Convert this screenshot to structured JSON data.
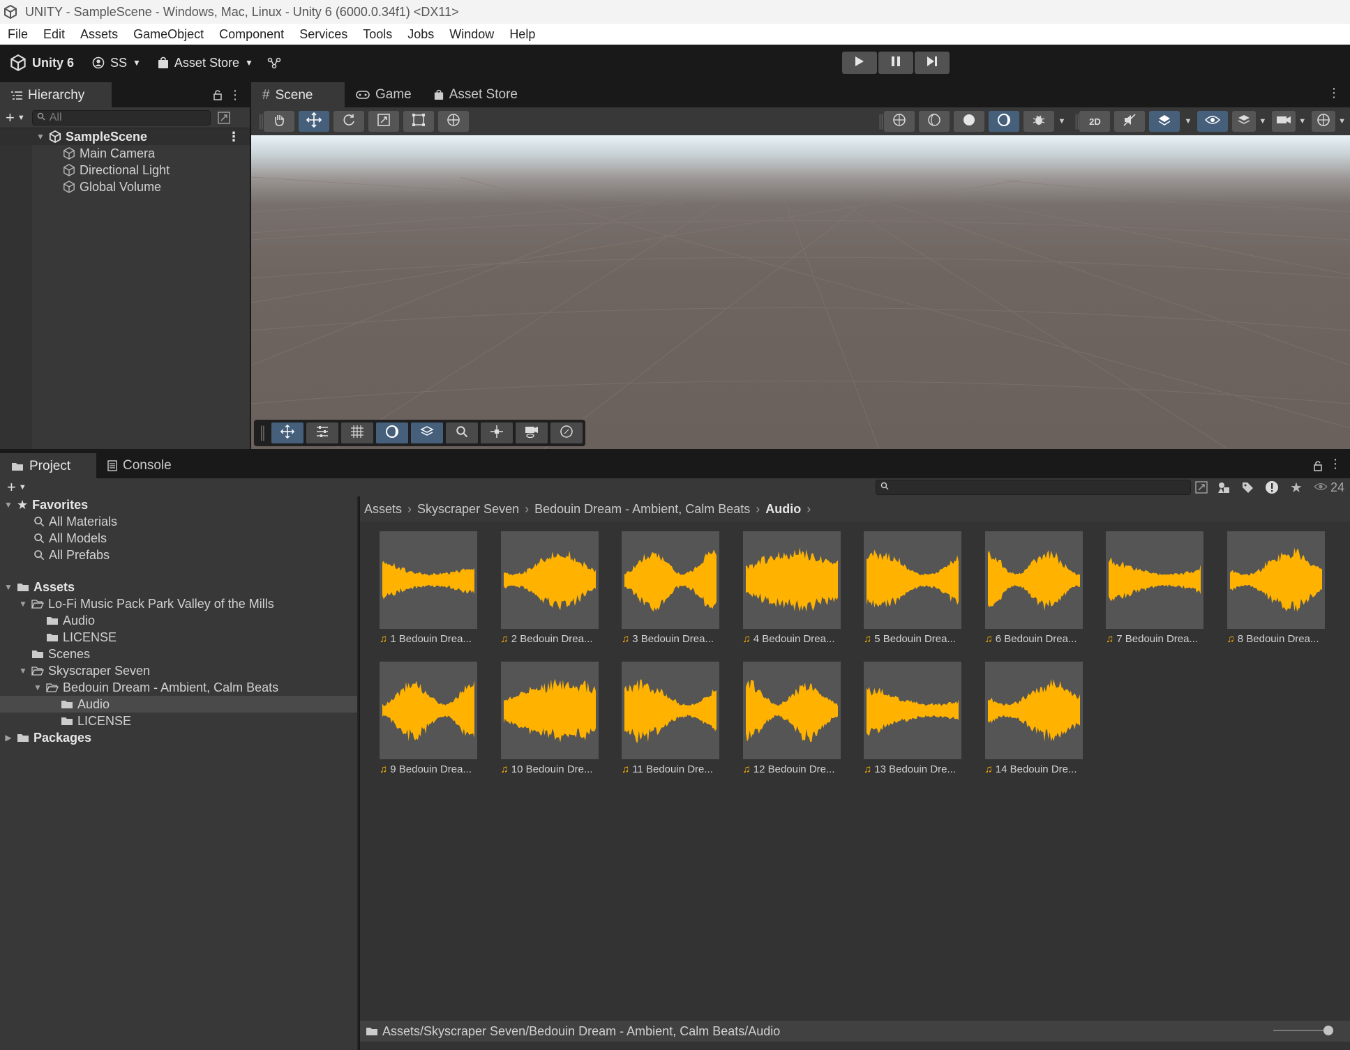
{
  "window": {
    "title": "UNITY - SampleScene - Windows, Mac, Linux - Unity 6 (6000.0.34f1) <DX11>"
  },
  "menu": [
    "File",
    "Edit",
    "Assets",
    "GameObject",
    "Component",
    "Services",
    "Tools",
    "Jobs",
    "Window",
    "Help"
  ],
  "toolbar": {
    "product": "Unity 6",
    "account": "SS",
    "asset_store": "Asset Store"
  },
  "hierarchy": {
    "tab": "Hierarchy",
    "search_placeholder": "All",
    "scene": "SampleScene",
    "items": [
      "Main Camera",
      "Directional Light",
      "Global Volume"
    ]
  },
  "scene_tabs": [
    "Scene",
    "Game",
    "Asset Store"
  ],
  "project": {
    "tabs": [
      "Project",
      "Console"
    ],
    "visible_count": "24",
    "favorites": {
      "label": "Favorites",
      "items": [
        "All Materials",
        "All Models",
        "All Prefabs"
      ]
    },
    "assets_label": "Assets",
    "tree": [
      {
        "label": "Lo-Fi Music Pack  Park Valley of the Mills",
        "level": 1,
        "arrow": "down"
      },
      {
        "label": "Audio",
        "level": 2,
        "arrow": ""
      },
      {
        "label": "LICENSE",
        "level": 2,
        "arrow": ""
      },
      {
        "label": "Scenes",
        "level": 1,
        "arrow": ""
      },
      {
        "label": "Skyscraper Seven",
        "level": 1,
        "arrow": "down"
      },
      {
        "label": "Bedouin Dream - Ambient, Calm Beats",
        "level": 2,
        "arrow": "down"
      },
      {
        "label": "Audio",
        "level": 3,
        "arrow": "",
        "selected": true
      },
      {
        "label": "LICENSE",
        "level": 3,
        "arrow": ""
      }
    ],
    "packages_label": "Packages",
    "breadcrumb": [
      "Assets",
      "Skyscraper Seven",
      "Bedouin Dream - Ambient, Calm Beats",
      "Audio"
    ],
    "assets": [
      "1 Bedouin Drea...",
      "2 Bedouin Drea...",
      "3 Bedouin Drea...",
      "4 Bedouin Drea...",
      "5 Bedouin Drea...",
      "6 Bedouin Drea...",
      "7 Bedouin Drea...",
      "8 Bedouin Drea...",
      "9 Bedouin Drea...",
      "10 Bedouin Dre...",
      "11 Bedouin Dre...",
      "12 Bedouin Dre...",
      "13 Bedouin Dre...",
      "14 Bedouin Dre..."
    ],
    "status_path": "Assets/Skyscraper Seven/Bedouin Dream - Ambient, Calm Beats/Audio"
  },
  "colors": {
    "waveform": "#ffb300",
    "selection": "#46607c",
    "panel": "#383838"
  }
}
